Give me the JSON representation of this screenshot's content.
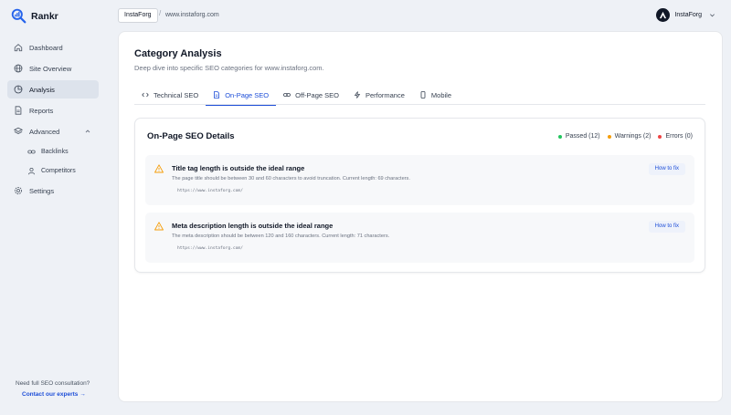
{
  "app": {
    "name": "Rankr"
  },
  "colors": {
    "accent": "#1d4ed8",
    "passed": "#22c55e",
    "warning": "#f59e0b",
    "error": "#ef4444"
  },
  "sidebar": {
    "items": [
      {
        "label": "Dashboard",
        "icon": "home-icon"
      },
      {
        "label": "Site Overview",
        "icon": "globe-icon"
      },
      {
        "label": "Analysis",
        "icon": "pie-chart-icon",
        "active": true
      },
      {
        "label": "Reports",
        "icon": "document-icon"
      },
      {
        "label": "Advanced",
        "icon": "layers-icon"
      }
    ],
    "sub_items": [
      {
        "label": "Backlinks",
        "icon": "link-icon"
      },
      {
        "label": "Competitors",
        "icon": "users-icon"
      }
    ],
    "settings": {
      "label": "Settings",
      "icon": "gear-icon"
    },
    "footer": {
      "prompt": "Need full SEO consultation?",
      "link": "Contact our experts →"
    }
  },
  "topbar": {
    "site_chip": "InstaForg",
    "separator": "/",
    "url": "www.instaforg.com",
    "user": {
      "name": "InstaForg"
    }
  },
  "page": {
    "title": "Category Analysis",
    "subtitle": "Deep dive into specific SEO categories for www.instaforg.com."
  },
  "tabs": [
    {
      "label": "Technical SEO",
      "icon": "code-icon"
    },
    {
      "label": "On-Page SEO",
      "icon": "file-icon",
      "active": true
    },
    {
      "label": "Off-Page SEO",
      "icon": "link-icon"
    },
    {
      "label": "Performance",
      "icon": "lightning-icon"
    },
    {
      "label": "Mobile",
      "icon": "mobile-icon"
    }
  ],
  "details": {
    "title": "On-Page SEO Details",
    "legend": {
      "passed": "Passed (12)",
      "warnings": "Warnings (2)",
      "errors": "Errors (0)"
    },
    "issues": [
      {
        "title": "Title tag length is outside the ideal range",
        "description": "The page title should be between 30 and 60 characters to avoid truncation. Current length: 69 characters.",
        "url": "https://www.instaforg.com/",
        "action": "How to fix"
      },
      {
        "title": "Meta description length is outside the ideal range",
        "description": "The meta description should be between 120 and 160 characters. Current length: 71 characters.",
        "url": "https://www.instaforg.com/",
        "action": "How to fix"
      }
    ]
  }
}
